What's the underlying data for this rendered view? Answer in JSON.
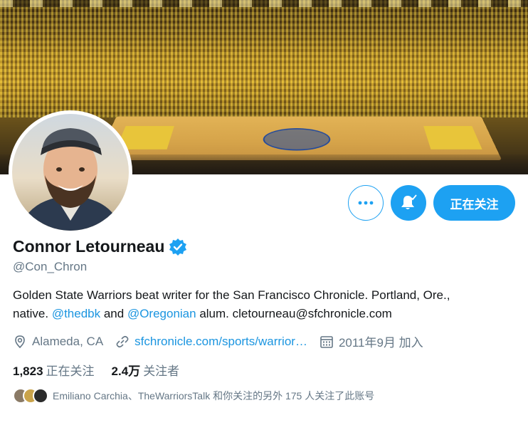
{
  "profile": {
    "name": "Connor Letourneau",
    "handle": "@Con_Chron",
    "bio": {
      "line1": "Golden State Warriors beat writer for the San Francisco Chronicle. Portland, Ore.,",
      "prefix": "native. ",
      "mention1": "@thedbk",
      "and": " and ",
      "mention2": "@Oregonian",
      "suffix": " alum. cletourneau@sfchronicle.com"
    },
    "location": "Alameda, CA",
    "website": "sfchronicle.com/sports/warrior…",
    "joined": "2011年9月 加入"
  },
  "actions": {
    "follow_label": "正在关注"
  },
  "stats": {
    "following_count": "1,823",
    "following_label": "正在关注",
    "followers_count": "2.4万",
    "followers_label": "关注者"
  },
  "followed_by": {
    "text": "Emiliano Carchia、TheWarriorsTalk 和你关注的另外 175 人关注了此账号"
  },
  "colors": {
    "accent": "#1da1f2",
    "link": "#1b95e0",
    "secondary_text": "#657786"
  },
  "icons": [
    "more-icon",
    "notification-bell-icon",
    "verified-badge-icon",
    "location-icon",
    "link-icon",
    "calendar-icon"
  ]
}
